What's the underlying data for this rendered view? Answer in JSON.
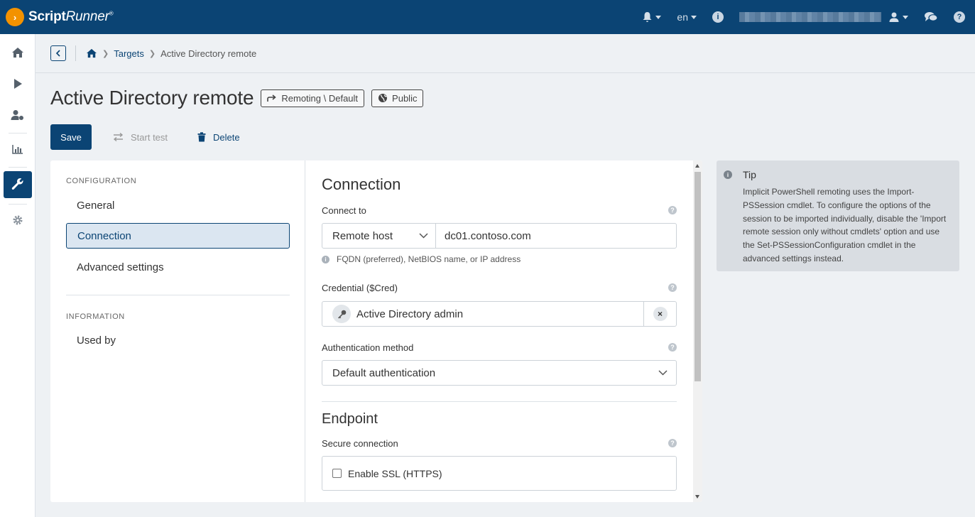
{
  "app": {
    "brand": "ScriptRunner",
    "lang": "en"
  },
  "breadcrumb": {
    "targets": "Targets",
    "current": "Active Directory remote"
  },
  "page": {
    "title": "Active Directory remote",
    "chip_type": "Remoting \\ Default",
    "chip_scope": "Public"
  },
  "actions": {
    "save": "Save",
    "start_test": "Start test",
    "delete": "Delete"
  },
  "leftnav": {
    "configuration": "CONFIGURATION",
    "items": [
      "General",
      "Connection",
      "Advanced settings"
    ],
    "information": "INFORMATION",
    "info_items": [
      "Used by"
    ]
  },
  "form": {
    "connection_heading": "Connection",
    "connect_to_label": "Connect to",
    "connect_type": "Remote host",
    "host_value": "dc01.contoso.com",
    "host_hint": "FQDN (preferred), NetBIOS name, or IP address",
    "credential_label": "Credential ($Cred)",
    "credential_value": "Active Directory admin",
    "auth_label": "Authentication method",
    "auth_value": "Default authentication",
    "endpoint_heading": "Endpoint",
    "secure_label": "Secure connection",
    "ssl_label": "Enable SSL (HTTPS)"
  },
  "tip": {
    "heading": "Tip",
    "body": "Implicit PowerShell remoting uses the Import-PSSession cmdlet. To configure the options of the session to be imported individually, disable the 'Import remote session only without cmdlets' option and use the Set-PSSessionConfiguration cmdlet in the advanced settings instead."
  }
}
